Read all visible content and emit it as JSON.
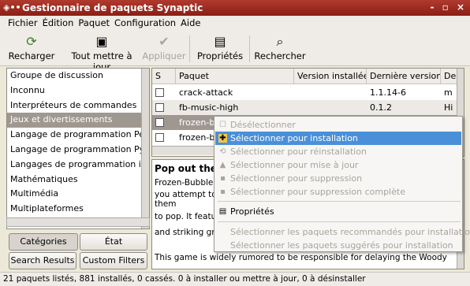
{
  "window": {
    "title": "Gestionnaire de paquets Synaptic",
    "controls": "- ▫ ×"
  },
  "menu": [
    "Fichier",
    "Édition",
    "Paquet",
    "Configuration",
    "Aide"
  ],
  "toolbar": {
    "reload": "Recharger",
    "mark_all": "Tout mettre à jour",
    "apply": "Appliquer",
    "properties": "Propriétés",
    "search": "Rechercher"
  },
  "sections": [
    "Groupe de discussion",
    "Inconnu",
    "Interpréteurs de commandes",
    "Jeux et divertissements",
    "Langage de programmation Pe",
    "Langage de programmation Py",
    "Langages de programmation ir",
    "Mathématiques",
    "Multimédia",
    "Multiplateformes"
  ],
  "selected_section": "Jeux et divertissements",
  "left_buttons": {
    "categories": "Catégories",
    "state": "État",
    "search_results": "Search Results",
    "custom_filters": "Custom Filters"
  },
  "table": {
    "headers": {
      "s": "S",
      "package": "Paquet",
      "installed": "Version installée",
      "latest": "Dernière version",
      "desc": "De"
    },
    "rows": [
      {
        "package": "crack-attack",
        "installed": "",
        "latest": "1.1.14-6",
        "desc": "m"
      },
      {
        "package": "fb-music-high",
        "installed": "",
        "latest": "0.1.2",
        "desc": "Hi"
      },
      {
        "package": "frozen-b",
        "installed": "",
        "latest": "",
        "desc": ""
      },
      {
        "package": "frozen-b",
        "installed": "",
        "latest": "",
        "desc": ""
      }
    ]
  },
  "description": {
    "title": "Pop out the",
    "lines": [
      "Frozen-Bubble",
      "you attempt to",
      "them",
      "to pop. It featu",
      "and striking gr"
    ],
    "bottom": "This game is widely rumored to be responsible for delaying the Woody"
  },
  "context_menu": {
    "items": [
      {
        "label": "Désélectionner",
        "enabled": false,
        "icon": "unmark-icon"
      },
      {
        "label": "Sélectionner pour installation",
        "enabled": true,
        "highlighted": true,
        "icon": "install-icon"
      },
      {
        "label": "Sélectionner pour réinstallation",
        "enabled": false,
        "icon": "reinstall-icon"
      },
      {
        "label": "Sélectionner pour mise à jour",
        "enabled": false,
        "icon": "upgrade-icon"
      },
      {
        "label": "Sélectionner pour suppression",
        "enabled": false,
        "icon": "remove-icon"
      },
      {
        "label": "Sélectionner pour suppression complète",
        "enabled": false,
        "icon": "purge-icon"
      },
      {
        "label": "Propriétés",
        "enabled": true,
        "icon": "properties-icon"
      },
      {
        "label": "Sélectionner les paquets recommandés pour installation",
        "enabled": false,
        "icon": ""
      },
      {
        "label": "Sélectionner les paquets suggérés pour installation",
        "enabled": false,
        "icon": ""
      }
    ]
  },
  "status": "21 paquets listés, 881 installés, 0 cassés. 0 à installer ou mettre à jour, 0 à désinstaller"
}
